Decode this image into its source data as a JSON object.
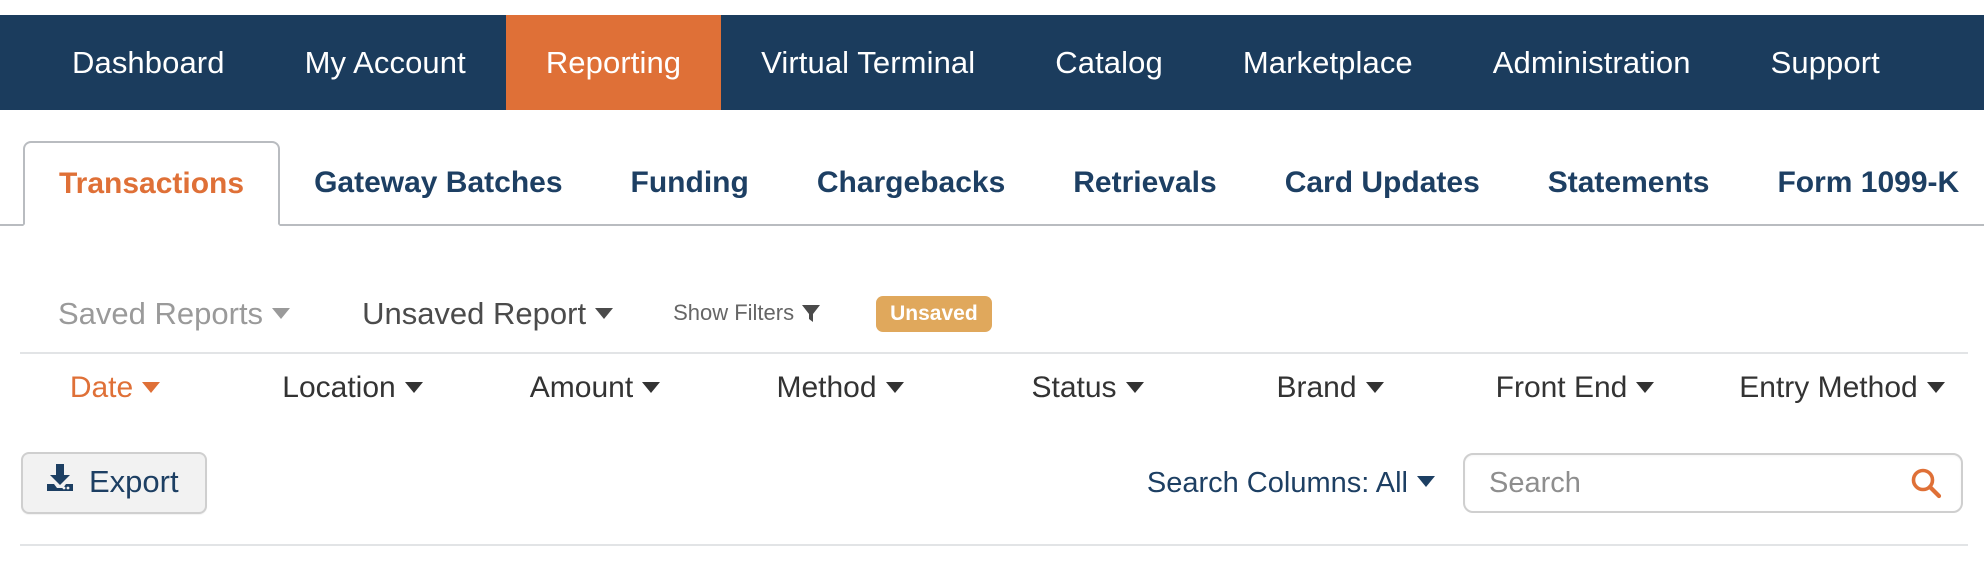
{
  "topnav": {
    "background": "#1b3c5d",
    "active_background": "#df7037",
    "items": [
      {
        "label": "Dashboard",
        "active": false
      },
      {
        "label": "My Account",
        "active": false
      },
      {
        "label": "Reporting",
        "active": true
      },
      {
        "label": "Virtual Terminal",
        "active": false
      },
      {
        "label": "Catalog",
        "active": false
      },
      {
        "label": "Marketplace",
        "active": false
      },
      {
        "label": "Administration",
        "active": false
      },
      {
        "label": "Support",
        "active": false
      }
    ]
  },
  "tabs": {
    "accent": "#df7037",
    "items": [
      {
        "label": "Transactions",
        "active": true
      },
      {
        "label": "Gateway Batches",
        "active": false
      },
      {
        "label": "Funding",
        "active": false
      },
      {
        "label": "Chargebacks",
        "active": false
      },
      {
        "label": "Retrievals",
        "active": false
      },
      {
        "label": "Card Updates",
        "active": false
      },
      {
        "label": "Statements",
        "active": false
      },
      {
        "label": "Form 1099-K",
        "active": false
      }
    ]
  },
  "report_bar": {
    "saved_reports_label": "Saved Reports",
    "unsaved_report_label": "Unsaved Report",
    "show_filters_label": "Show Filters",
    "badge_label": "Unsaved",
    "badge_color": "#e0a85c"
  },
  "columns": [
    {
      "label": "Date",
      "sorted": true
    },
    {
      "label": "Location",
      "sorted": false
    },
    {
      "label": "Amount",
      "sorted": false
    },
    {
      "label": "Method",
      "sorted": false
    },
    {
      "label": "Status",
      "sorted": false
    },
    {
      "label": "Brand",
      "sorted": false
    },
    {
      "label": "Front End",
      "sorted": false
    },
    {
      "label": "Entry Method",
      "sorted": false
    }
  ],
  "actions": {
    "export_label": "Export",
    "search_columns_label": "Search Columns:",
    "search_columns_value": "All",
    "search_placeholder": "Search",
    "search_value": "",
    "search_icon_color": "#df7037"
  }
}
